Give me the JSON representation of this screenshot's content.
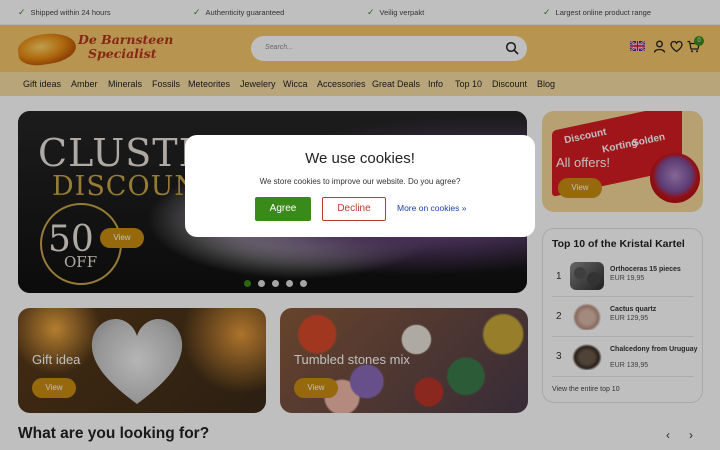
{
  "usp": [
    "Shipped within 24 hours",
    "Authenticity guaranteed",
    "Veilig verpakt",
    "Largest online product range"
  ],
  "logo": {
    "line1": "De Barnsteen",
    "line2": "Specialist"
  },
  "search": {
    "placeholder": "Search..."
  },
  "cart": {
    "count": "0"
  },
  "nav": [
    "Gift ideas",
    "Amber",
    "Minerals",
    "Fossils",
    "Meteorites",
    "Jewelery",
    "Wicca",
    "Accessories",
    "Great Deals",
    "Info",
    "Top 10",
    "Discount",
    "Blog"
  ],
  "hero": {
    "title": "CLUSTE",
    "subtitle": "DISCOUN",
    "big": "50",
    "off": "OFF",
    "button": "View"
  },
  "promo": {
    "word1": "Discount",
    "word2": "Korting",
    "word3": "Solden",
    "text": "All offers!",
    "button": "View"
  },
  "cards": [
    {
      "title": "Gift idea",
      "button": "View"
    },
    {
      "title": "Tumbled stones mix",
      "button": "View"
    }
  ],
  "top10": {
    "title": "Top 10 of the Kristal Kartel",
    "items": [
      {
        "num": "1",
        "name": "Orthoceras 15 pieces",
        "price": "EUR 19,95"
      },
      {
        "num": "2",
        "name": "Cactus quartz",
        "price": "EUR 129,95"
      },
      {
        "num": "3",
        "name": "Chalcedony from Uruguay",
        "price": "EUR 139,95"
      }
    ],
    "link": "View the entire top 10"
  },
  "section": {
    "title": "What are you looking for?",
    "prev": "‹",
    "next": "›"
  },
  "cookie": {
    "title": "We use cookies!",
    "text": "We store cookies to improve our website. Do you agree?",
    "agree": "Agree",
    "decline": "Decline",
    "more": "More on cookies »"
  },
  "colors": {
    "accent": "#3a8a1a",
    "header": "#f5c66a",
    "nav": "#f7dca3",
    "button": "#c98d12",
    "decline": "#c0392b",
    "link": "#1b3fa8"
  }
}
